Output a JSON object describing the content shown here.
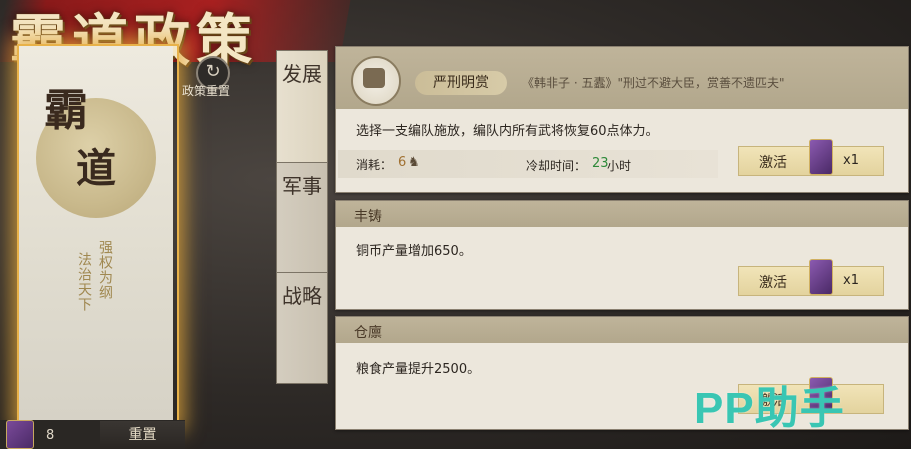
{
  "title": "霸道政策",
  "left_card": {
    "emblem_top": "霸",
    "emblem_bottom": "道",
    "motto_col1": "强权为纲",
    "motto_col2": "法治天下",
    "reset_policy_label": "政策重置"
  },
  "bottom_bar": {
    "token_count": "8",
    "reset_button": "重置"
  },
  "tabs": [
    {
      "label": "发展",
      "active": true
    },
    {
      "label": "军事",
      "active": false
    },
    {
      "label": "战略",
      "active": false
    }
  ],
  "policies": [
    {
      "name": "严刑明赏",
      "quote": "《韩非子 · 五蠹》\"刑过不避大臣，赏善不遗匹夫\"",
      "description": "选择一支编队施放，编队内所有武将恢复60点体力。",
      "cost_label": "消耗：",
      "cost_value": "6",
      "cooldown_label": "冷却时间：",
      "cooldown_value": "23",
      "cooldown_unit": "小时",
      "activate_label": "激活",
      "activate_count": "x1"
    },
    {
      "name": "丰铸",
      "description": "铜币产量增加650。",
      "activate_label": "激活",
      "activate_count": "x1"
    },
    {
      "name": "仓廪",
      "description": "粮食产量提升2500。",
      "activate_label": "激活"
    }
  ],
  "watermark": "PP助手",
  "colors": {
    "banner_red": "#a82020",
    "card_glow": "#e8b24a",
    "cooldown_green": "#2f8a3a",
    "watermark": "#39c6b3"
  }
}
